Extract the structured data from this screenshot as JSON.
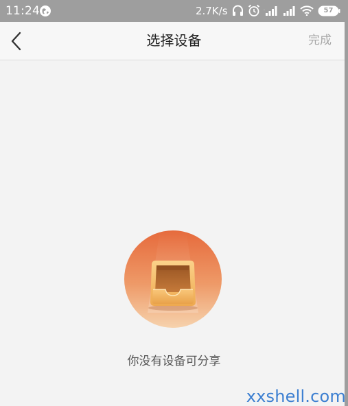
{
  "status_bar": {
    "time": "11:24",
    "network_speed": "2.7K/s",
    "battery_level": "57",
    "icons": [
      "globe-icon",
      "headset-icon",
      "alarm-icon",
      "signal-icon",
      "signal-icon",
      "wifi-icon",
      "battery-icon"
    ]
  },
  "header": {
    "title": "选择设备",
    "done_label": "完成",
    "back_icon": "chevron-left-icon"
  },
  "empty_state": {
    "message": "你没有设备可分享",
    "illustration_icon": "empty-tray-icon",
    "colors": {
      "circle_top": "#e8784a",
      "circle_bottom": "#f4c8a0",
      "tray": "#f0b45a"
    }
  },
  "watermark": {
    "text": "xxshell.com",
    "color": "#3c7fd1"
  }
}
